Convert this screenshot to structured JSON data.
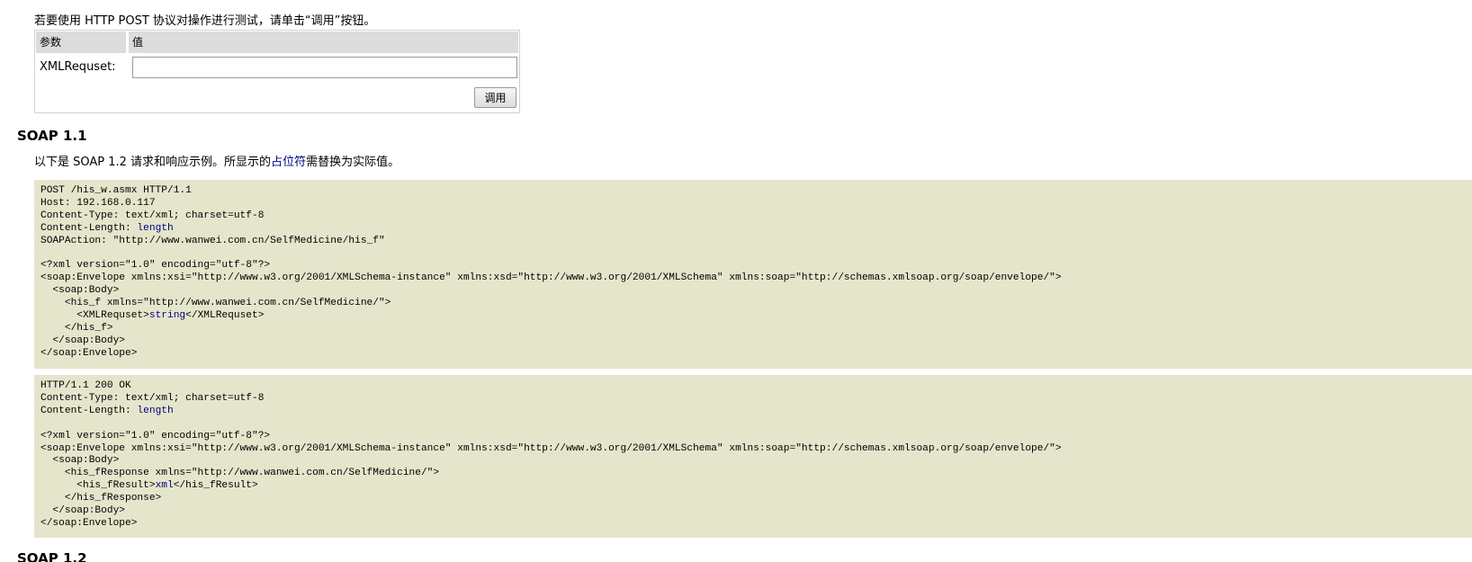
{
  "intro": {
    "text": "若要使用 HTTP POST 协议对操作进行测试，请单击“调用”按钮。"
  },
  "form": {
    "header_param": "参数",
    "header_value": "值",
    "param_name": "XMLRequset:",
    "param_value": "",
    "invoke_label": "调用"
  },
  "soap11": {
    "title": "SOAP 1.1",
    "note_before": "以下是 SOAP 1.2 请求和响应示例。所显示的",
    "note_link": "占位符",
    "note_after": "需替换为实际值。",
    "request_lines": [
      [
        {
          "t": "POST /his_w.asmx HTTP/1.1"
        }
      ],
      [
        {
          "t": "Host: 192.168.0.117"
        }
      ],
      [
        {
          "t": "Content-Type: text/xml; charset=utf-8"
        }
      ],
      [
        {
          "t": "Content-Length: "
        },
        {
          "t": "length",
          "ph": true
        }
      ],
      [
        {
          "t": "SOAPAction: \"http://www.wanwei.com.cn/SelfMedicine/his_f\""
        }
      ],
      [
        {
          "t": ""
        }
      ],
      [
        {
          "t": "<?xml version=\"1.0\" encoding=\"utf-8\"?>"
        }
      ],
      [
        {
          "t": "<soap:Envelope xmlns:xsi=\"http://www.w3.org/2001/XMLSchema-instance\" xmlns:xsd=\"http://www.w3.org/2001/XMLSchema\" xmlns:soap=\"http://schemas.xmlsoap.org/soap/envelope/\">"
        }
      ],
      [
        {
          "t": "  <soap:Body>"
        }
      ],
      [
        {
          "t": "    <his_f xmlns=\"http://www.wanwei.com.cn/SelfMedicine/\">"
        }
      ],
      [
        {
          "t": "      <XMLRequset>"
        },
        {
          "t": "string",
          "ph": true
        },
        {
          "t": "</XMLRequset>"
        }
      ],
      [
        {
          "t": "    </his_f>"
        }
      ],
      [
        {
          "t": "  </soap:Body>"
        }
      ],
      [
        {
          "t": "</soap:Envelope>"
        }
      ]
    ],
    "response_lines": [
      [
        {
          "t": "HTTP/1.1 200 OK"
        }
      ],
      [
        {
          "t": "Content-Type: text/xml; charset=utf-8"
        }
      ],
      [
        {
          "t": "Content-Length: "
        },
        {
          "t": "length",
          "ph": true
        }
      ],
      [
        {
          "t": ""
        }
      ],
      [
        {
          "t": "<?xml version=\"1.0\" encoding=\"utf-8\"?>"
        }
      ],
      [
        {
          "t": "<soap:Envelope xmlns:xsi=\"http://www.w3.org/2001/XMLSchema-instance\" xmlns:xsd=\"http://www.w3.org/2001/XMLSchema\" xmlns:soap=\"http://schemas.xmlsoap.org/soap/envelope/\">"
        }
      ],
      [
        {
          "t": "  <soap:Body>"
        }
      ],
      [
        {
          "t": "    <his_fResponse xmlns=\"http://www.wanwei.com.cn/SelfMedicine/\">"
        }
      ],
      [
        {
          "t": "      <his_fResult>"
        },
        {
          "t": "xml",
          "ph": true
        },
        {
          "t": "</his_fResult>"
        }
      ],
      [
        {
          "t": "    </his_fResponse>"
        }
      ],
      [
        {
          "t": "  </soap:Body>"
        }
      ],
      [
        {
          "t": "</soap:Envelope>"
        }
      ]
    ]
  },
  "soap12": {
    "title": "SOAP 1.2"
  },
  "colors": {
    "code_background": "#e5e5cc",
    "placeholder_text": "#000080",
    "table_header": "#dcdcdc"
  }
}
